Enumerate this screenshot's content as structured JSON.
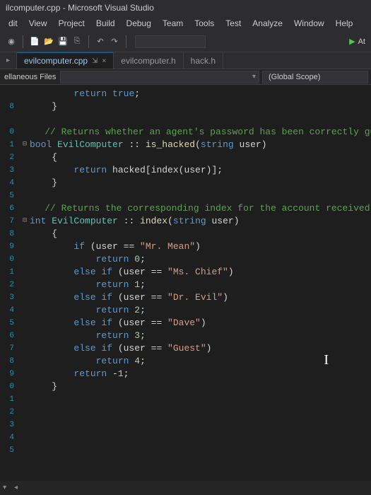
{
  "window": {
    "title": "ilcomputer.cpp - Microsoft Visual Studio"
  },
  "menu": {
    "items": [
      "dit",
      "View",
      "Project",
      "Build",
      "Debug",
      "Team",
      "Tools",
      "Test",
      "Analyze",
      "Window",
      "Help"
    ]
  },
  "toolbar": {
    "run_label": "At"
  },
  "tabs": {
    "items": [
      {
        "name": "evilcomputer.cpp",
        "active": true
      },
      {
        "name": "evilcomputer.h",
        "active": false
      },
      {
        "name": "hack.h",
        "active": false
      }
    ],
    "pin_label": "⇲",
    "close_label": "×"
  },
  "nav": {
    "left_label": "ellaneous Files",
    "scope": "(Global Scope)"
  },
  "code": {
    "lines": [
      {
        "n": "",
        "frag": [
          {
            "c": "pn",
            "t": "        "
          },
          {
            "c": "kw",
            "t": "return"
          },
          {
            "c": "pn",
            "t": " "
          },
          {
            "c": "kw",
            "t": "true"
          },
          {
            "c": "pn",
            "t": ";"
          }
        ]
      },
      {
        "n": "8",
        "frag": [
          {
            "c": "pn",
            "t": "    }"
          }
        ]
      },
      {
        "n": "",
        "frag": [
          {
            "c": "pn",
            "t": ""
          }
        ]
      },
      {
        "n": "0",
        "frag": [
          {
            "c": "pn",
            "t": "    "
          },
          {
            "c": "cm",
            "t": "// Returns whether an agent's password has been correctly guessed"
          }
        ]
      },
      {
        "n": "1",
        "fold": "⊟",
        "frag": [
          {
            "c": "type",
            "t": "bool"
          },
          {
            "c": "pn",
            "t": " "
          },
          {
            "c": "cls",
            "t": "EvilComputer"
          },
          {
            "c": "pn",
            "t": " :: "
          },
          {
            "c": "fn",
            "t": "is_hacked"
          },
          {
            "c": "pn",
            "t": "("
          },
          {
            "c": "type",
            "t": "string"
          },
          {
            "c": "pn",
            "t": " user)"
          }
        ]
      },
      {
        "n": "2",
        "frag": [
          {
            "c": "pn",
            "t": "    {"
          }
        ]
      },
      {
        "n": "3",
        "frag": [
          {
            "c": "pn",
            "t": "        "
          },
          {
            "c": "kw",
            "t": "return"
          },
          {
            "c": "pn",
            "t": " hacked[index(user)];"
          }
        ]
      },
      {
        "n": "4",
        "frag": [
          {
            "c": "pn",
            "t": "    }"
          }
        ]
      },
      {
        "n": "5",
        "frag": [
          {
            "c": "pn",
            "t": ""
          }
        ]
      },
      {
        "n": "6",
        "frag": [
          {
            "c": "pn",
            "t": "    "
          },
          {
            "c": "cm",
            "t": "// Returns the corresponding index for the account received"
          }
        ]
      },
      {
        "n": "7",
        "fold": "⊟",
        "frag": [
          {
            "c": "type",
            "t": "int"
          },
          {
            "c": "pn",
            "t": " "
          },
          {
            "c": "cls",
            "t": "EvilComputer"
          },
          {
            "c": "pn",
            "t": " :: "
          },
          {
            "c": "fn",
            "t": "index"
          },
          {
            "c": "pn",
            "t": "("
          },
          {
            "c": "type",
            "t": "string"
          },
          {
            "c": "pn",
            "t": " user)"
          }
        ]
      },
      {
        "n": "8",
        "frag": [
          {
            "c": "pn",
            "t": "    {"
          }
        ]
      },
      {
        "n": "9",
        "frag": [
          {
            "c": "pn",
            "t": "        "
          },
          {
            "c": "kw",
            "t": "if"
          },
          {
            "c": "pn",
            "t": " (user == "
          },
          {
            "c": "str",
            "t": "\"Mr. Mean\""
          },
          {
            "c": "pn",
            "t": ")"
          }
        ]
      },
      {
        "n": "0",
        "frag": [
          {
            "c": "pn",
            "t": "            "
          },
          {
            "c": "kw",
            "t": "return"
          },
          {
            "c": "pn",
            "t": " "
          },
          {
            "c": "num",
            "t": "0"
          },
          {
            "c": "pn",
            "t": ";"
          }
        ]
      },
      {
        "n": "1",
        "frag": [
          {
            "c": "pn",
            "t": "        "
          },
          {
            "c": "kw",
            "t": "else if"
          },
          {
            "c": "pn",
            "t": " (user == "
          },
          {
            "c": "str",
            "t": "\"Ms. Chief\""
          },
          {
            "c": "pn",
            "t": ")"
          }
        ]
      },
      {
        "n": "2",
        "frag": [
          {
            "c": "pn",
            "t": "            "
          },
          {
            "c": "kw",
            "t": "return"
          },
          {
            "c": "pn",
            "t": " "
          },
          {
            "c": "num",
            "t": "1"
          },
          {
            "c": "pn",
            "t": ";"
          }
        ]
      },
      {
        "n": "3",
        "frag": [
          {
            "c": "pn",
            "t": "        "
          },
          {
            "c": "kw",
            "t": "else if"
          },
          {
            "c": "pn",
            "t": " (user == "
          },
          {
            "c": "str",
            "t": "\"Dr. Evil\""
          },
          {
            "c": "pn",
            "t": ")"
          }
        ]
      },
      {
        "n": "4",
        "frag": [
          {
            "c": "pn",
            "t": "            "
          },
          {
            "c": "kw",
            "t": "return"
          },
          {
            "c": "pn",
            "t": " "
          },
          {
            "c": "num",
            "t": "2"
          },
          {
            "c": "pn",
            "t": ";"
          }
        ]
      },
      {
        "n": "5",
        "frag": [
          {
            "c": "pn",
            "t": "        "
          },
          {
            "c": "kw",
            "t": "else if"
          },
          {
            "c": "pn",
            "t": " (user == "
          },
          {
            "c": "str",
            "t": "\"Dave\""
          },
          {
            "c": "pn",
            "t": ")"
          }
        ]
      },
      {
        "n": "6",
        "frag": [
          {
            "c": "pn",
            "t": "            "
          },
          {
            "c": "kw",
            "t": "return"
          },
          {
            "c": "pn",
            "t": " "
          },
          {
            "c": "num",
            "t": "3"
          },
          {
            "c": "pn",
            "t": ";"
          }
        ]
      },
      {
        "n": "7",
        "frag": [
          {
            "c": "pn",
            "t": "        "
          },
          {
            "c": "kw",
            "t": "else if"
          },
          {
            "c": "pn",
            "t": " (user == "
          },
          {
            "c": "str",
            "t": "\"Guest\""
          },
          {
            "c": "pn",
            "t": ")"
          }
        ]
      },
      {
        "n": "8",
        "frag": [
          {
            "c": "pn",
            "t": "            "
          },
          {
            "c": "kw",
            "t": "return"
          },
          {
            "c": "pn",
            "t": " "
          },
          {
            "c": "num",
            "t": "4"
          },
          {
            "c": "pn",
            "t": ";"
          }
        ]
      },
      {
        "n": "9",
        "frag": [
          {
            "c": "pn",
            "t": "        "
          },
          {
            "c": "kw",
            "t": "return"
          },
          {
            "c": "pn",
            "t": " -"
          },
          {
            "c": "num",
            "t": "1"
          },
          {
            "c": "pn",
            "t": ";"
          }
        ]
      },
      {
        "n": "0",
        "frag": [
          {
            "c": "pn",
            "t": "    }"
          }
        ]
      },
      {
        "n": "1",
        "frag": [
          {
            "c": "pn",
            "t": ""
          }
        ]
      },
      {
        "n": "2",
        "frag": [
          {
            "c": "pn",
            "t": ""
          }
        ]
      },
      {
        "n": "3",
        "frag": [
          {
            "c": "pn",
            "t": ""
          }
        ]
      },
      {
        "n": "4",
        "frag": [
          {
            "c": "pn",
            "t": ""
          }
        ]
      },
      {
        "n": "5",
        "frag": [
          {
            "c": "pn",
            "t": ""
          }
        ]
      }
    ]
  },
  "cursor_glyph": "I"
}
